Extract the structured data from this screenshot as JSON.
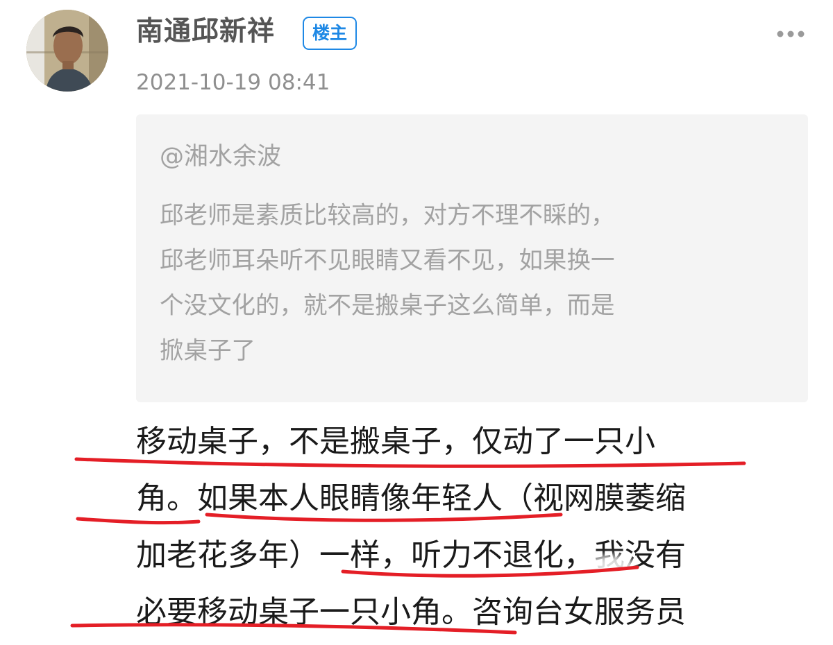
{
  "post": {
    "author": {
      "name": "南通邱新祥",
      "badge": "楼主"
    },
    "timestamp": "2021-10-19 08:41",
    "more_icon": "more-dots-icon",
    "quote": {
      "author": "@湘水余波",
      "lines": [
        "邱老师是素质比较高的，对方不理不睬的，",
        "邱老师耳朵听不见眼睛又看不见，如果换一",
        "个没文化的，就不是搬桌子这么简单，而是",
        "掀桌子了"
      ]
    },
    "body_lines": [
      "移动桌子，不是搬桌子，仅动了一只小",
      "角。如果本人眼睛像年轻人（视网膜萎缩",
      "加老花多年）一样，听力不退化，我没有",
      "必要移动桌子一只小角。咨询台女服务员"
    ]
  },
  "colors": {
    "badge_blue": "#1e88e5",
    "name_gray": "#555555",
    "meta_gray": "#8f8f8f",
    "quote_bg": "#f4f4f4",
    "quote_text": "#a2a2a2",
    "body_text": "#1a1a1a",
    "annotation_red": "#e41e26"
  }
}
